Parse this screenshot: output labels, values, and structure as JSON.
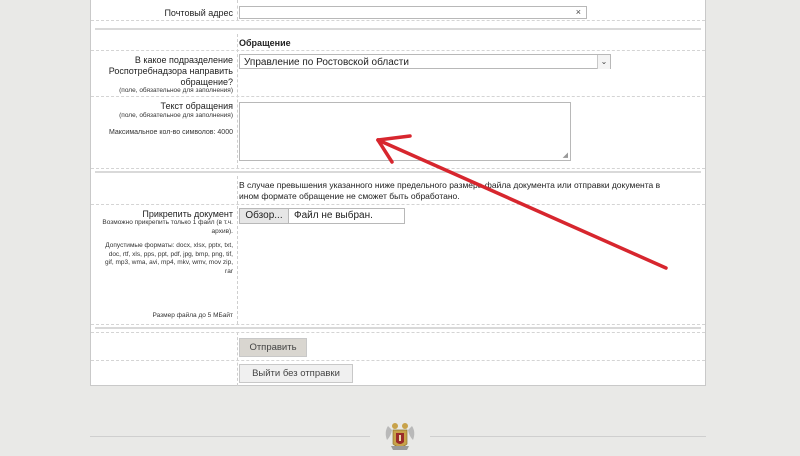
{
  "form": {
    "postal_label": "Почтовый адрес",
    "postal_clear": "×",
    "section_title": "Обращение",
    "department": {
      "label": "В какое подразделение Роспотребнадзора направить обращение?",
      "required_note": "(поле, обязательное для заполнения)",
      "selected": "Управление по Ростовской области",
      "chevron": "⌄"
    },
    "message": {
      "label": "Текст обращения",
      "required_note": "(поле, обязательное для заполнения)",
      "max_chars": "Максимальное кол-во символов: 4000"
    },
    "attach_notice": "В случае превышения указанного ниже предельного размера файла документа или отправки документа в ином формате обращение не сможет быть обработано.",
    "attach": {
      "label": "Прикрепить документ",
      "hint": "Возможно прикрепить только 1 файл (в т.ч. архив).",
      "formats": "Допустимые форматы: docx, xlsx, pptx, txt, doc, rtf, xls, pps, ppt, pdf, jpg, bmp, png, tif, gif, mp3, wma, avi, mp4, mkv, wmv, mov zip, rar",
      "size": "Размер файла до 5 МБайт",
      "browse_label": "Обзор...",
      "file_status": "Файл не выбран."
    },
    "submit_label": "Отправить",
    "exit_label": "Выйти без отправки"
  },
  "footer": {
    "emblem_icon": "rospotrebnadzor-emblem-icon"
  },
  "annotation": {
    "arrow_color": "#d7262e"
  }
}
